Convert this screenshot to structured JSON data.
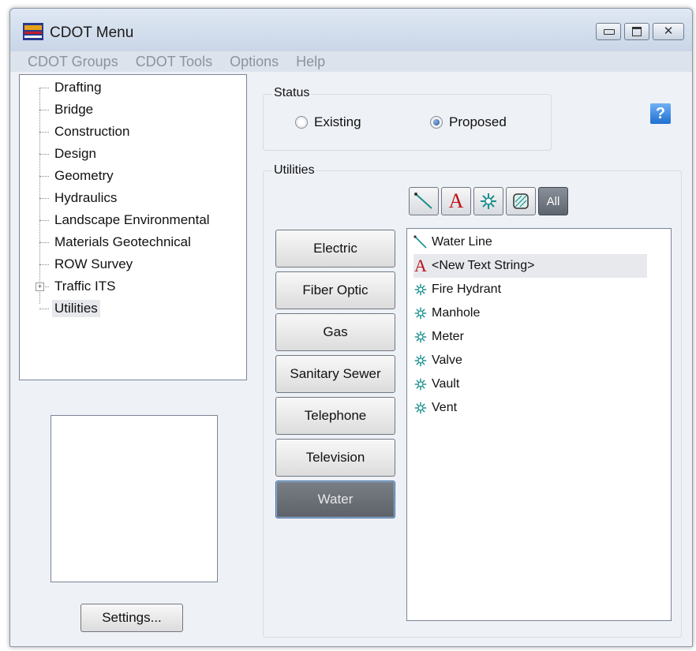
{
  "window": {
    "title": "CDOT Menu"
  },
  "menu": [
    "CDOT Groups",
    "CDOT Tools",
    "Options",
    "Help"
  ],
  "tree": {
    "items": [
      "Drafting",
      "Bridge",
      "Construction",
      "Design",
      "Geometry",
      "Hydraulics",
      "Landscape Environmental",
      "Materials Geotechnical",
      "ROW Survey",
      "Traffic ITS",
      "Utilities"
    ],
    "selected": "Utilities",
    "expandable": "Traffic ITS",
    "expander_glyph": "+"
  },
  "settings_label": "Settings...",
  "status": {
    "label": "Status",
    "options": [
      "Existing",
      "Proposed"
    ],
    "selected": "Proposed"
  },
  "help_glyph": "?",
  "utilities": {
    "label": "Utilities",
    "filter_all_label": "All",
    "filter_icons": [
      "line-icon",
      "text-icon",
      "cell-icon",
      "pattern-icon"
    ],
    "categories": [
      "Electric",
      "Fiber Optic",
      "Gas",
      "Sanitary Sewer",
      "Telephone",
      "Television",
      "Water"
    ],
    "active_category": "Water",
    "items": [
      {
        "label": "Water Line",
        "icon": "line-icon"
      },
      {
        "label": "<New Text String>",
        "icon": "text-icon"
      },
      {
        "label": "Fire Hydrant",
        "icon": "cell-icon"
      },
      {
        "label": "Manhole",
        "icon": "cell-icon"
      },
      {
        "label": "Meter",
        "icon": "cell-icon"
      },
      {
        "label": "Valve",
        "icon": "cell-icon"
      },
      {
        "label": "Vault",
        "icon": "cell-icon"
      },
      {
        "label": "Vent",
        "icon": "cell-icon"
      }
    ],
    "highlighted_item": "<New Text String>"
  },
  "colors": {
    "text_icon": "#c0121a",
    "line_icon": "#1a8f8f",
    "cell_icon": "#1a8f8f",
    "active_button": "#6b7078"
  }
}
